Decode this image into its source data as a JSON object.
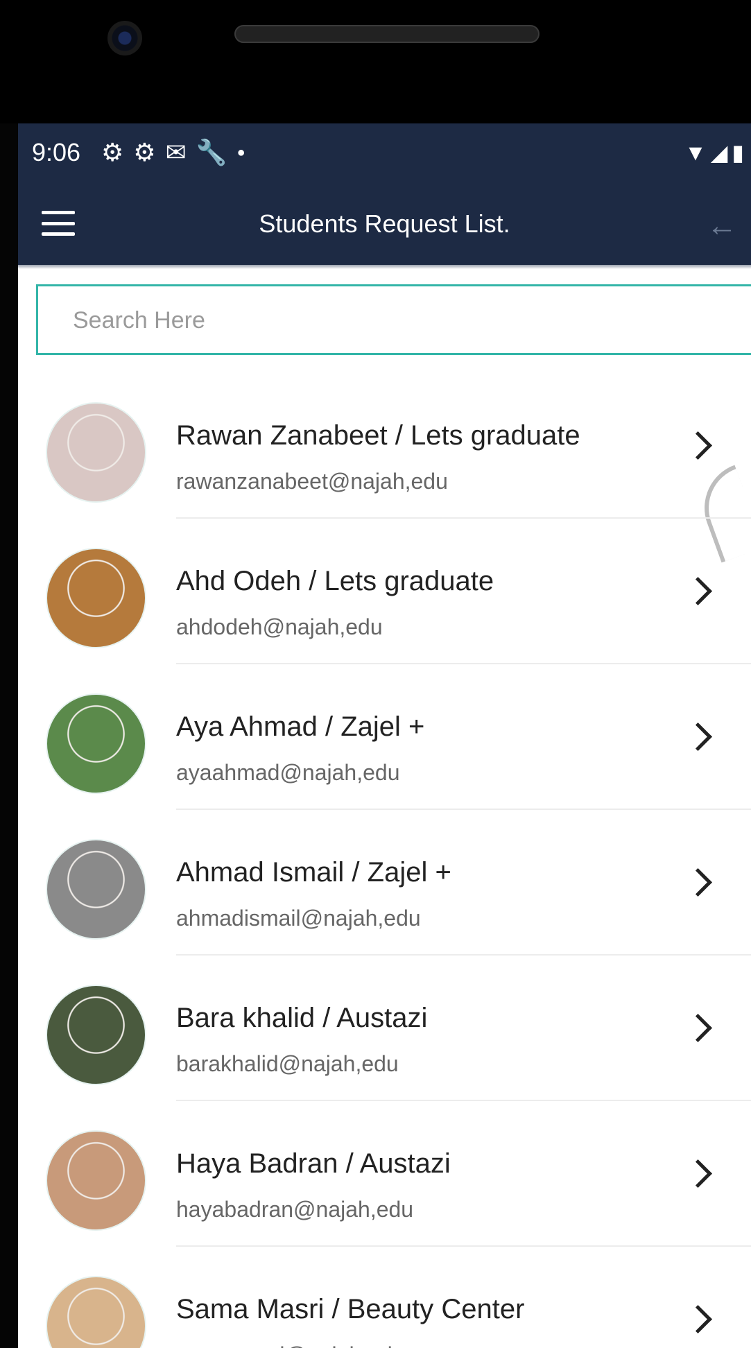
{
  "status_bar": {
    "time": "9:06",
    "left_icons": [
      "settings-icon",
      "settings-icon",
      "gmail-icon",
      "wrench-icon",
      "dot-icon"
    ],
    "right_icons": [
      "wifi-icon",
      "signal-icon",
      "battery-icon"
    ]
  },
  "app_bar": {
    "title": "Students Request List.",
    "menu_icon": "hamburger-menu-icon",
    "back_icon": "back-arrow-icon"
  },
  "search": {
    "placeholder": "Search Here",
    "value": ""
  },
  "students": [
    {
      "name": "Rawan Zanabeet",
      "project": "Lets graduate",
      "title": "Rawan Zanabeet  /  Lets graduate",
      "email": "rawanzanabeet@najah,edu",
      "avatar_color": "#d9c7c4"
    },
    {
      "name": "Ahd Odeh",
      "project": "Lets graduate",
      "title": "Ahd Odeh  /  Lets graduate",
      "email": "ahdodeh@najah,edu",
      "avatar_color": "#b57a3c"
    },
    {
      "name": "Aya Ahmad",
      "project": "Zajel +",
      "title": "Aya Ahmad  /  Zajel +",
      "email": "ayaahmad@najah,edu",
      "avatar_color": "#5b8a4b"
    },
    {
      "name": "Ahmad Ismail",
      "project": "Zajel +",
      "title": "Ahmad Ismail  /  Zajel +",
      "email": "ahmadismail@najah,edu",
      "avatar_color": "#8a8a8a"
    },
    {
      "name": "Bara khalid",
      "project": "Austazi",
      "title": "Bara khalid   /  Austazi",
      "email": "barakhalid@najah,edu",
      "avatar_color": "#4a5a3e"
    },
    {
      "name": "Haya Badran",
      "project": "Austazi",
      "title": "Haya Badran  /  Austazi",
      "email": "hayabadran@najah,edu",
      "avatar_color": "#c89a7a"
    },
    {
      "name": "Sama Masri",
      "project": "Beauty Center",
      "title": "Sama Masri  /  Beauty Center",
      "email": "samamasri@najah.edu",
      "avatar_color": "#d8b48c"
    }
  ]
}
